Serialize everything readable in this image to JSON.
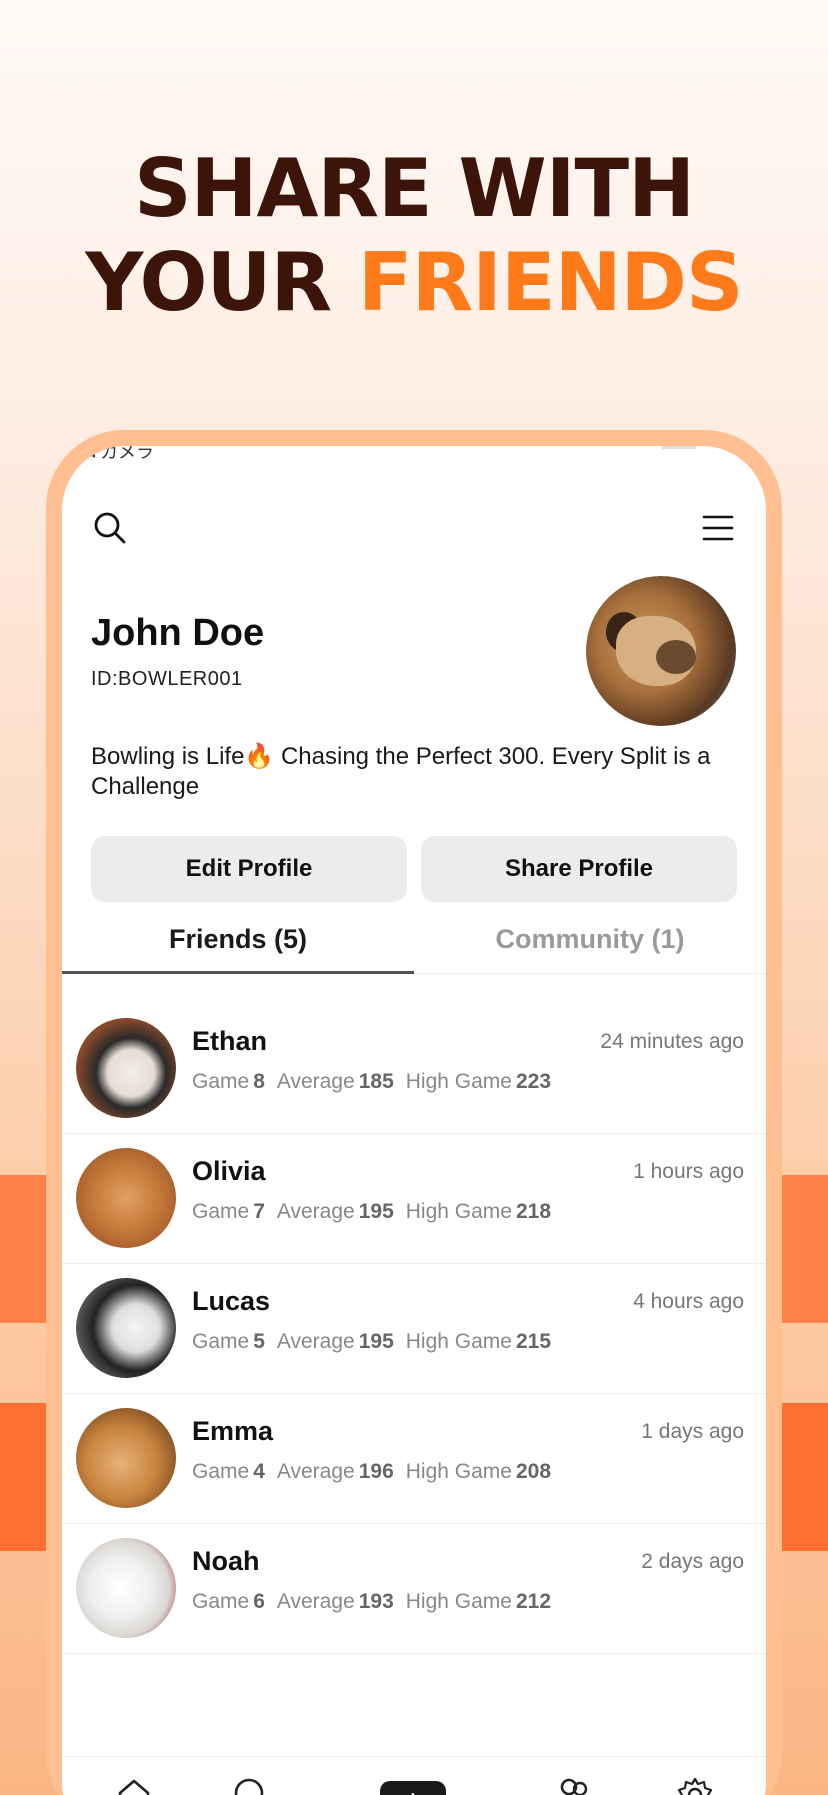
{
  "headline": {
    "line1": "SHARE WITH",
    "line2_prefix": "YOUR ",
    "line2_accent": "FRIENDS"
  },
  "status": {
    "back_label": "◂ カメラ"
  },
  "profile": {
    "name": "John Doe",
    "id": "ID:BOWLER001",
    "bio": "Bowling is Life🔥 Chasing the Perfect 300. Every Split is a Challenge"
  },
  "buttons": {
    "edit": "Edit Profile",
    "share": "Share Profile"
  },
  "tabs": {
    "friends": "Friends (5)",
    "community": "Community (1)"
  },
  "stat_labels": {
    "game": "Game",
    "average": "Average",
    "high_game": "High Game"
  },
  "friends": [
    {
      "name": "Ethan",
      "time": "24 minutes ago",
      "game": "8",
      "average": "185",
      "high_game": "223"
    },
    {
      "name": "Olivia",
      "time": "1 hours ago",
      "game": "7",
      "average": "195",
      "high_game": "218"
    },
    {
      "name": "Lucas",
      "time": "4 hours ago",
      "game": "5",
      "average": "195",
      "high_game": "215"
    },
    {
      "name": "Emma",
      "time": "1 days ago",
      "game": "4",
      "average": "196",
      "high_game": "208"
    },
    {
      "name": "Noah",
      "time": "2 days ago",
      "game": "6",
      "average": "193",
      "high_game": "212"
    }
  ],
  "colors": {
    "headline_dark": "#3d1409",
    "headline_accent": "#ff7a1a",
    "phone_frame": "#ffbf90"
  },
  "icons": {
    "search": "search-icon",
    "menu": "hamburger-menu-icon",
    "home": "home-icon",
    "add": "plus-icon",
    "friends": "friends-icon",
    "settings": "gear-icon"
  }
}
